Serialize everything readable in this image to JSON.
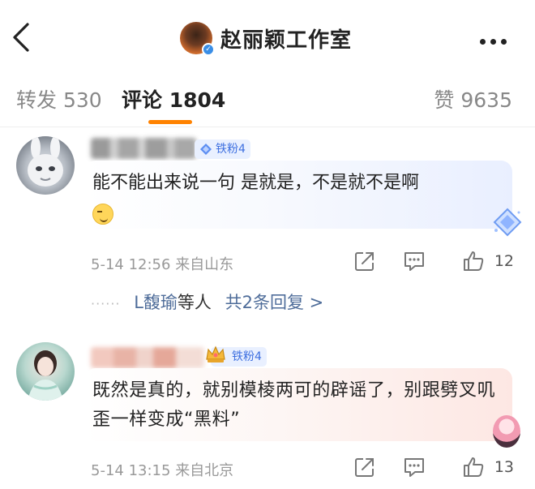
{
  "header": {
    "title": "赵丽颖工作室",
    "back_icon": "chevron-left-icon",
    "more_icon": "more-dots-icon"
  },
  "tabs": {
    "repost_label": "转发",
    "repost_count": "530",
    "comments_label": "评论",
    "comments_count": "1804",
    "likes_label": "赞",
    "likes_count": "9635",
    "active": "comments",
    "accent": "#ff8200"
  },
  "comments": [
    {
      "badge": "铁粉4",
      "text": "能不能出来说一句 是就是，不是就不是啊",
      "emoji": "smirk-emoji-icon",
      "date": "5-14 12:56",
      "location": "来自山东",
      "likes": "12",
      "replies_preview": {
        "name": "L馥瑜",
        "suffix": "等人",
        "count_text": "共2条回复 >"
      }
    },
    {
      "badge": "铁粉4",
      "text": "既然是真的，就别模棱两可的辟谣了，别跟劈叉叽歪一样变成“黑料”",
      "date": "5-14 13:15",
      "location": "来自北京",
      "likes": "13"
    }
  ],
  "colors": {
    "link": "#4f6d9a",
    "badge_text": "#3d6fe0",
    "badge_bg": "#e9f0ff",
    "meta": "#999999"
  }
}
